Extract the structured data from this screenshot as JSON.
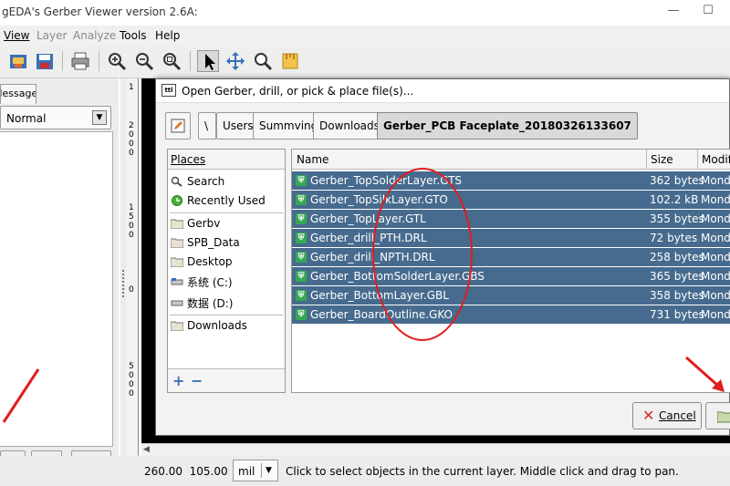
{
  "window": {
    "title": "gEDA's Gerber Viewer version 2.6A:",
    "minimize": "—",
    "maximize": "☐"
  },
  "menu": [
    {
      "label": "View",
      "disabled": false
    },
    {
      "label": "Layer",
      "disabled": true
    },
    {
      "label": "Analyze",
      "disabled": true
    },
    {
      "label": "Tools",
      "disabled": false
    },
    {
      "label": "Help",
      "disabled": false
    }
  ],
  "toolbar": {
    "icons": [
      "open-project-icon",
      "save-project-icon",
      "print-icon",
      "zoom-in-icon",
      "zoom-out-icon",
      "zoom-fit-icon",
      "pointer-tool-icon",
      "pan-tool-icon",
      "zoom-tool-icon",
      "measure-tool-icon"
    ]
  },
  "left_panel": {
    "tab_label": "Messages",
    "render_mode": "Normal",
    "buttons": [
      "move-down-icon",
      "move-up-icon",
      "remove-layer-icon"
    ]
  },
  "ruler": {
    "labels": [
      "1",
      "2",
      "0",
      "0",
      "0",
      "1",
      "5",
      "0",
      "0",
      "0",
      "5",
      "0",
      "0",
      "0"
    ]
  },
  "status": {
    "coord_x": "260.00",
    "coord_y": "105.00",
    "unit": "mil",
    "message": "Click to select objects in the current layer. Middle click and drag to pan."
  },
  "dialog": {
    "title": "Open Gerber, drill, or pick & place file(s)...",
    "icon_text": "ttl",
    "path": [
      "\\",
      "Users",
      "Summving",
      "Downloads",
      "Gerber_PCB Faceplate_20180326133607"
    ],
    "places_header": "Places",
    "places": [
      {
        "label": "Search",
        "icon": "search-icon"
      },
      {
        "label": "Recently Used",
        "icon": "recent-icon"
      },
      {
        "label": "Gerbv",
        "icon": "folder-icon"
      },
      {
        "label": "SPB_Data",
        "icon": "folder-icon"
      },
      {
        "label": "Desktop",
        "icon": "folder-icon"
      },
      {
        "label": "系统 (C:)",
        "icon": "drive-icon"
      },
      {
        "label": "数据 (D:)",
        "icon": "drive-icon"
      },
      {
        "label": "Downloads",
        "icon": "folder-icon"
      }
    ],
    "columns": {
      "name": "Name",
      "size": "Size",
      "modified": "Modified"
    },
    "files": [
      {
        "name": "Gerber_TopSolderLayer.GTS",
        "size": "362 bytes",
        "modified": "Monday"
      },
      {
        "name": "Gerber_TopSilkLayer.GTO",
        "size": "102.2 kB",
        "modified": "Monday"
      },
      {
        "name": "Gerber_TopLayer.GTL",
        "size": "355 bytes",
        "modified": "Monday"
      },
      {
        "name": "Gerber_drill_PTH.DRL",
        "size": "72 bytes",
        "modified": "Monday"
      },
      {
        "name": "Gerber_drill_NPTH.DRL",
        "size": "258 bytes",
        "modified": "Monday"
      },
      {
        "name": "Gerber_BottomSolderLayer.GBS",
        "size": "365 bytes",
        "modified": "Monday"
      },
      {
        "name": "Gerber_BottomLayer.GBL",
        "size": "358 bytes",
        "modified": "Monday"
      },
      {
        "name": "Gerber_BoardOutline.GKO",
        "size": "731 bytes",
        "modified": "Monday"
      }
    ],
    "cancel_label": "Cancel",
    "selection_color": "#476b8e"
  },
  "annotation": {
    "color": "#e11d1d"
  }
}
